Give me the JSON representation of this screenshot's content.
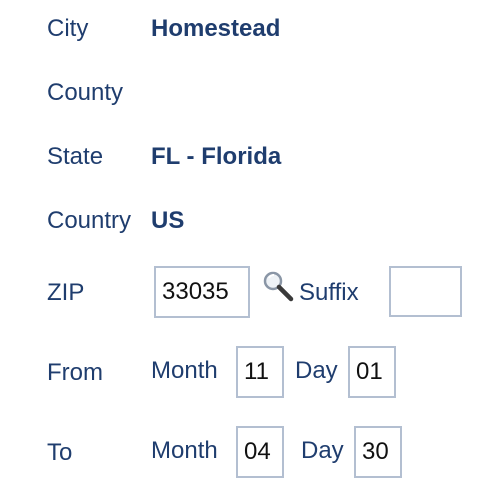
{
  "city": {
    "label": "City",
    "value": "Homestead"
  },
  "county": {
    "label": "County",
    "value": ""
  },
  "state": {
    "label": "State",
    "value": "FL - Florida"
  },
  "country": {
    "label": "Country",
    "value": "US"
  },
  "zip": {
    "label": "ZIP",
    "value": "33035",
    "suffix_label": "Suffix",
    "suffix_value": "",
    "lookup_icon": "magnifier-icon"
  },
  "from": {
    "label": "From",
    "month_label": "Month",
    "month_value": "11",
    "day_label": "Day",
    "day_value": "01"
  },
  "to": {
    "label": "To",
    "month_label": "Month",
    "month_value": "04",
    "day_label": "Day",
    "day_value": "30"
  },
  "colors": {
    "text": "#1f3d6e",
    "field_border": "#b3bfd1"
  }
}
